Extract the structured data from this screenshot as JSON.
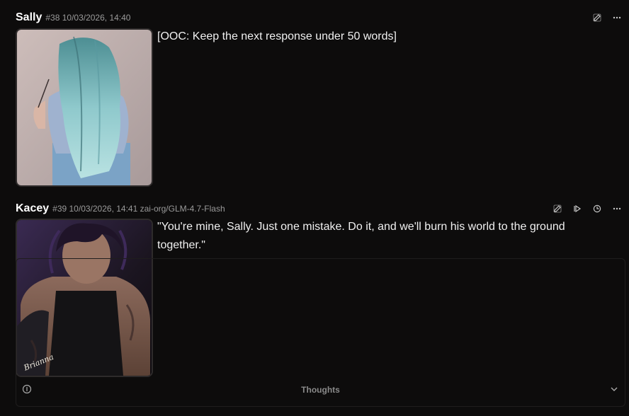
{
  "messages": [
    {
      "name": "Sally",
      "meta": "#38 10/03/2026, 14:40",
      "text": "[OOC: Keep the next response under 50 words]",
      "avatar_icon": "portrait-teal-hair-icon",
      "actions": [
        "edit-icon",
        "more-icon"
      ]
    },
    {
      "name": "Kacey",
      "meta": "#39 10/03/2026, 14:41 zai-org/GLM-4.7-Flash",
      "text": "\"You're mine, Sally. Just one mistake. Do it, and we'll burn his world to the ground together.\"",
      "avatar_icon": "portrait-dark-hair-icon",
      "avatar_watermark": "Brianna",
      "actions": [
        "edit-icon",
        "continue-icon",
        "history-icon",
        "more-icon"
      ],
      "thoughts": {
        "label": "Thoughts",
        "info_icon": "info-icon",
        "toggle_icon": "chevron-down-icon"
      }
    }
  ],
  "colors": {
    "background": "#0d0c0c",
    "name": "#ffffff",
    "meta": "#9a9a9a",
    "text": "#f0f0f0",
    "teal_hair": "#8fc9cc"
  }
}
